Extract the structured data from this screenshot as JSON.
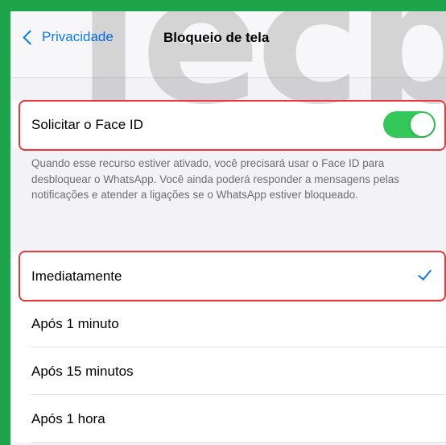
{
  "watermark": "Tecb",
  "navbar": {
    "back_label": "Privacidade",
    "title": "Bloqueio de tela"
  },
  "face_id": {
    "label": "Solicitar o Face ID",
    "enabled": true,
    "description": "Quando esse recurso estiver ativado, você precisará usar o Face ID para desbloquear o WhatsApp. Você ainda poderá responder a mensagens pelas notificações e atender a ligações se o WhatsApp estiver bloqueado."
  },
  "lock_options": [
    {
      "label": "Imediatamente",
      "selected": true
    },
    {
      "label": "Após 1 minuto",
      "selected": false
    },
    {
      "label": "Após 15 minutos",
      "selected": false
    },
    {
      "label": "Após 1 hora",
      "selected": false
    }
  ],
  "colors": {
    "accent": "#0a7aff",
    "toggle_on": "#34c759",
    "highlight": "#e8383d",
    "frame": "#1ea44b"
  },
  "icons": {
    "back": "chevron-left-icon",
    "selected": "checkmark-icon"
  }
}
